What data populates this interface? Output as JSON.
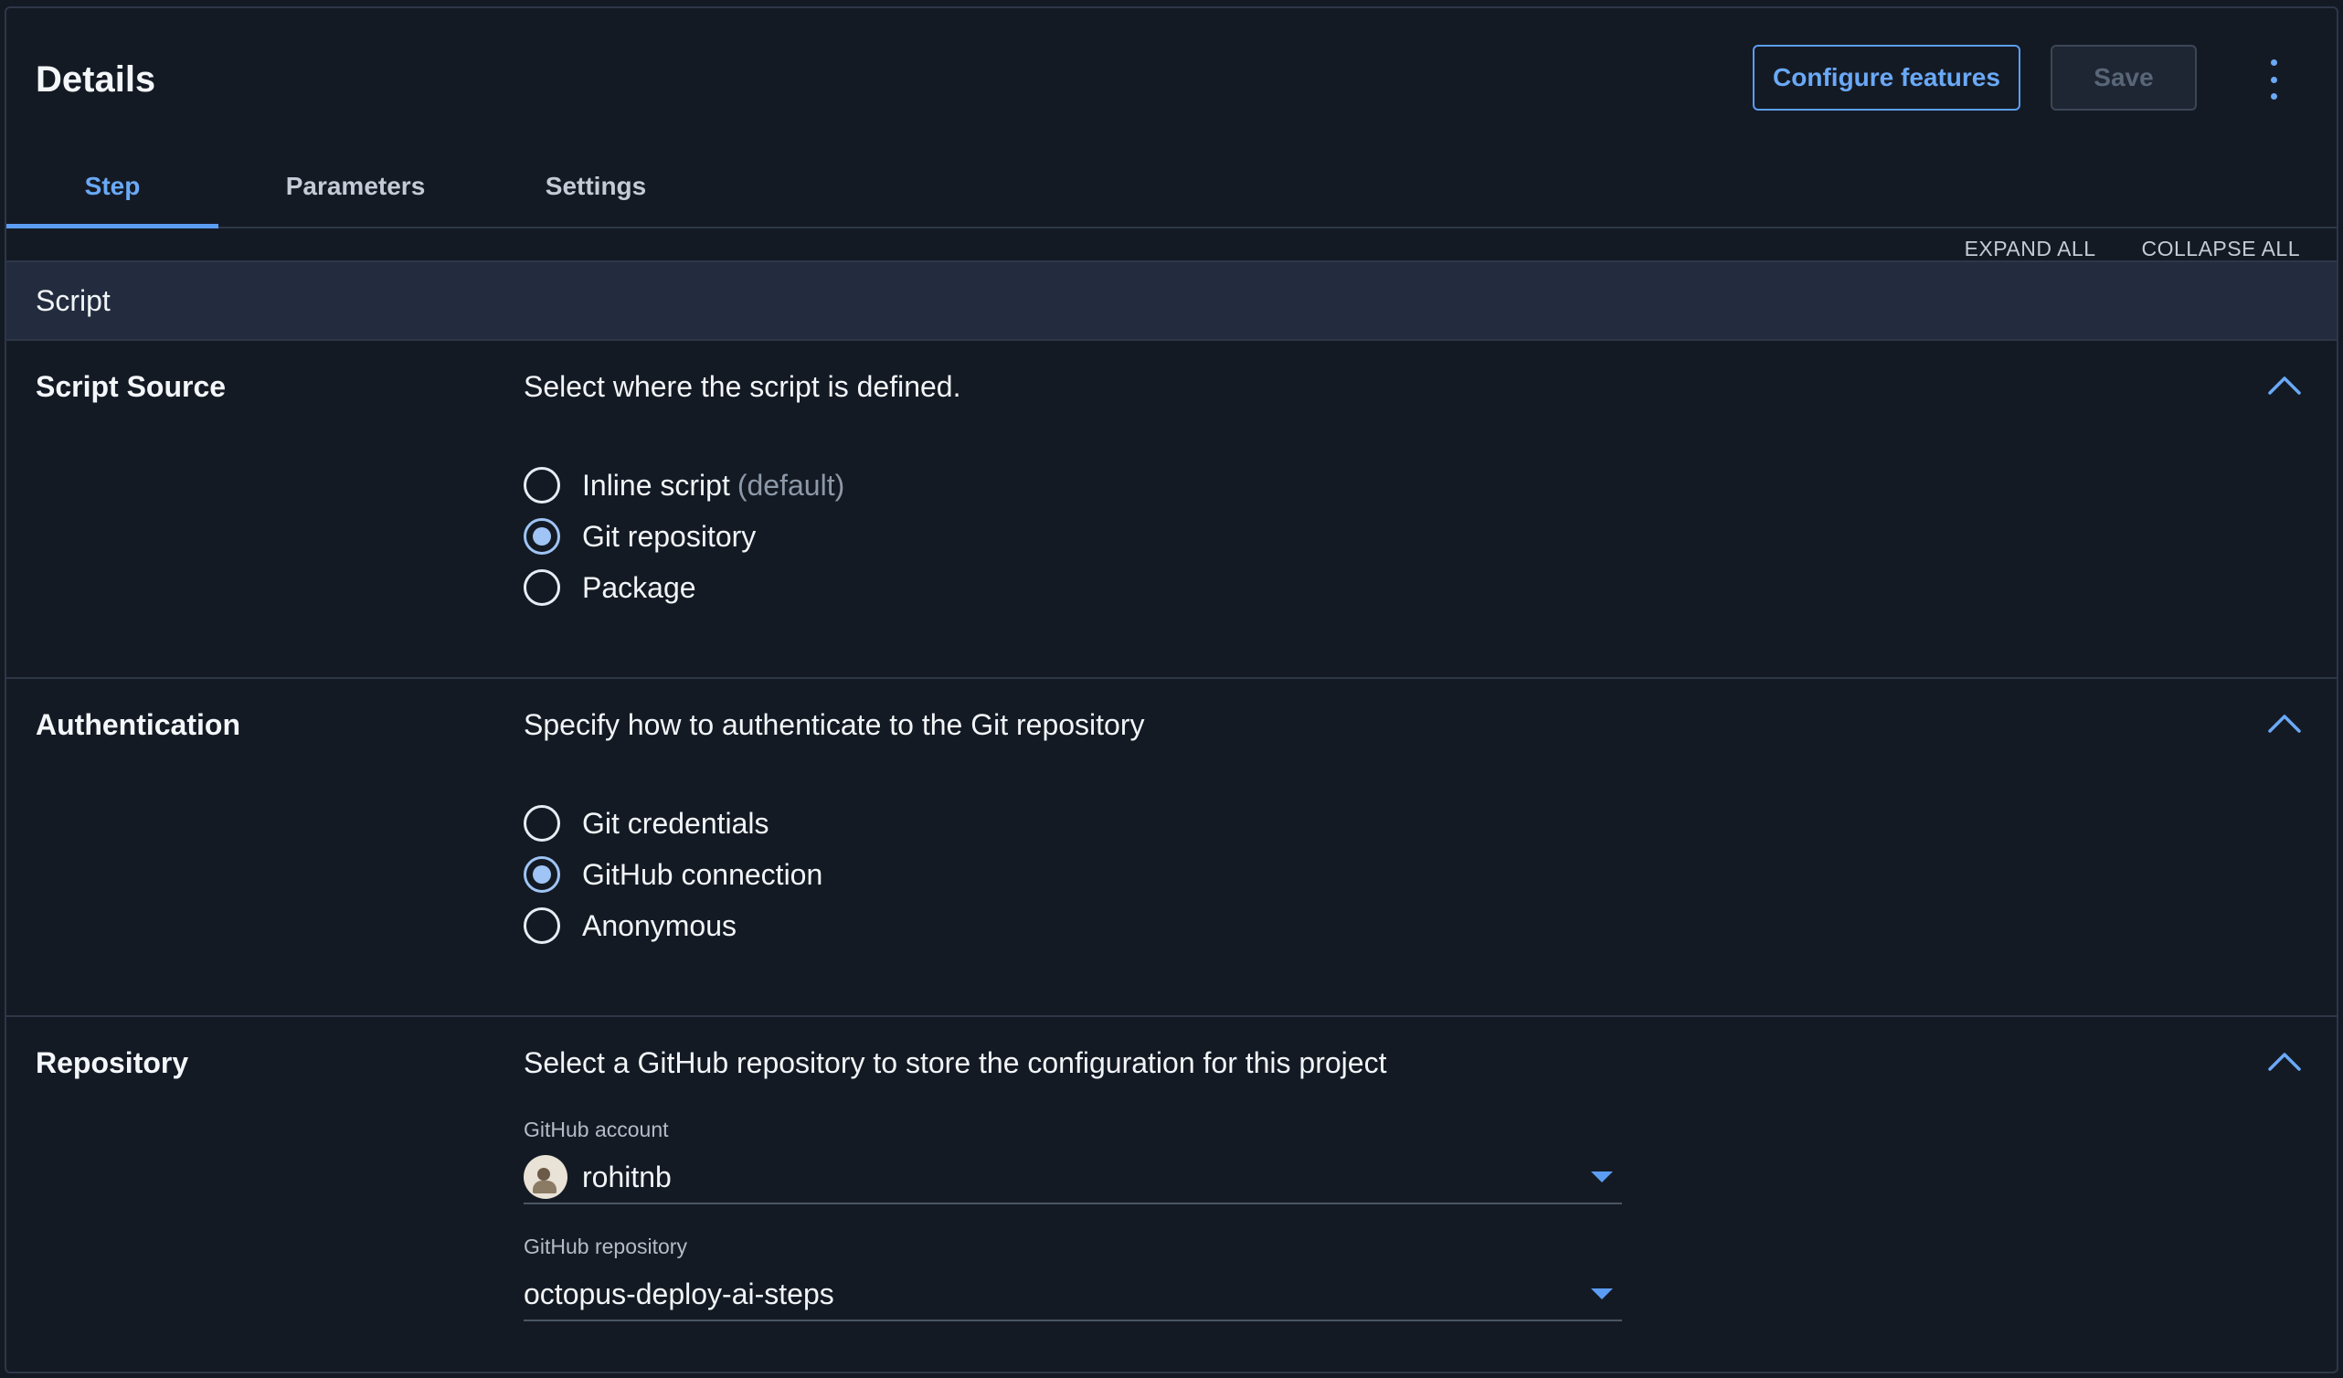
{
  "header": {
    "title": "Details",
    "configure_label": "Configure features",
    "save_label": "Save"
  },
  "tabs": [
    {
      "label": "Step",
      "active": true
    },
    {
      "label": "Parameters",
      "active": false
    },
    {
      "label": "Settings",
      "active": false
    }
  ],
  "toolbar": {
    "expand_all": "EXPAND ALL",
    "collapse_all": "COLLAPSE ALL"
  },
  "section": {
    "title": "Script"
  },
  "script_source": {
    "title": "Script Source",
    "description": "Select where the script is defined.",
    "options": [
      {
        "label": "Inline script",
        "hint": "(default)",
        "checked": false
      },
      {
        "label": "Git repository",
        "hint": "",
        "checked": true
      },
      {
        "label": "Package",
        "hint": "",
        "checked": false
      }
    ]
  },
  "authentication": {
    "title": "Authentication",
    "description": "Specify how to authenticate to the Git repository",
    "options": [
      {
        "label": "Git credentials",
        "checked": false
      },
      {
        "label": "GitHub connection",
        "checked": true
      },
      {
        "label": "Anonymous",
        "checked": false
      }
    ]
  },
  "repository": {
    "title": "Repository",
    "description": "Select a GitHub repository to store the configuration for this project",
    "account_label": "GitHub account",
    "account_value": "rohitnb",
    "repo_label": "GitHub repository",
    "repo_value": "octopus-deploy-ai-steps"
  },
  "colors": {
    "background": "#141a24",
    "accent": "#5b9df3",
    "section_header": "#222c3e"
  },
  "icons": [
    "kebab-menu-icon",
    "chevron-up-icon",
    "caret-down-icon",
    "avatar"
  ]
}
